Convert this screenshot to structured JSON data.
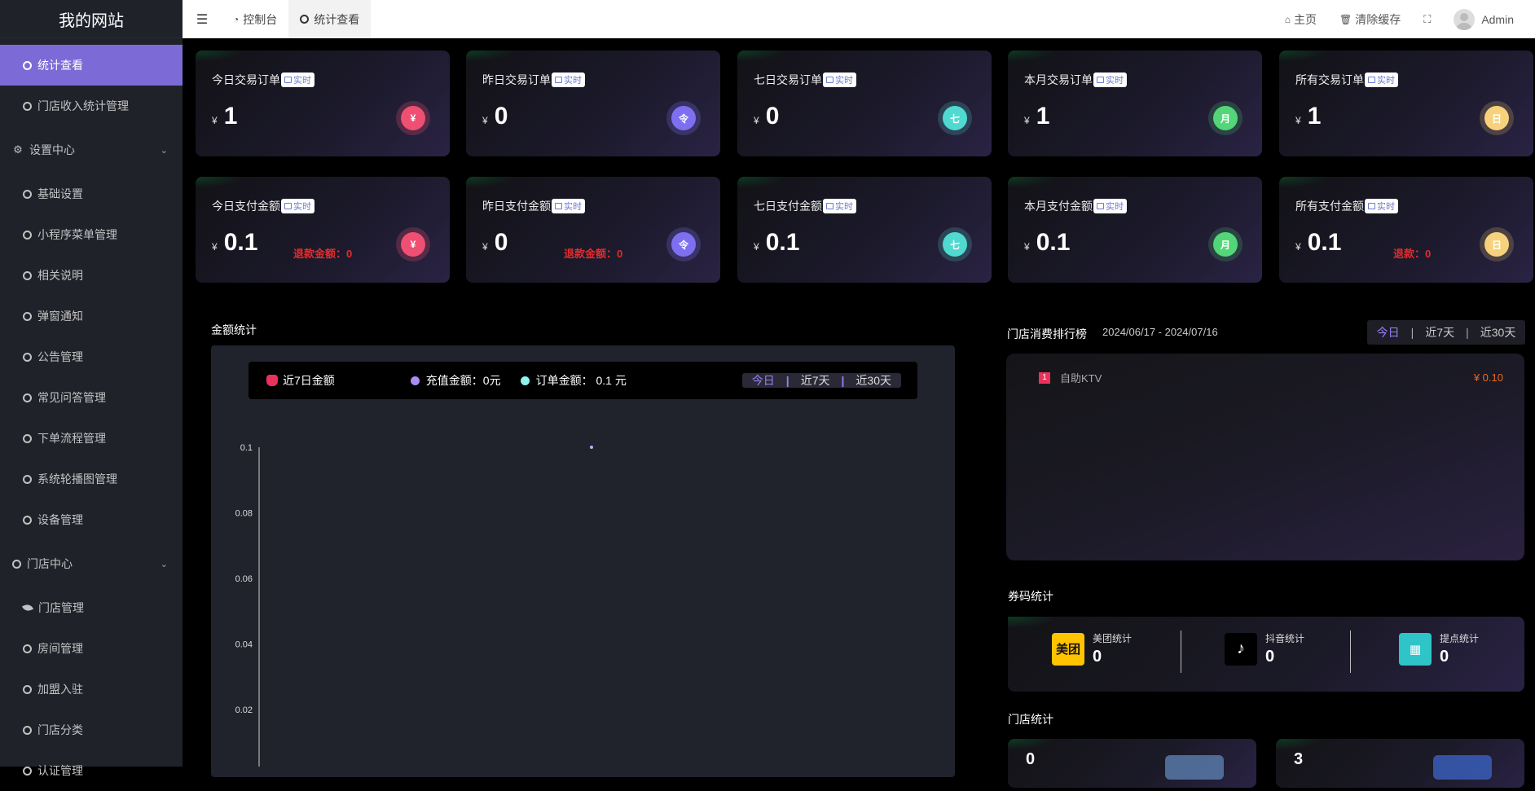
{
  "site": {
    "title": "我的网站"
  },
  "sidebar": {
    "items_top": [
      {
        "label": "统计查看",
        "active": true
      },
      {
        "label": "门店收入统计管理",
        "active": false
      }
    ],
    "group_settings": {
      "label": "设置中心",
      "icon": "gears-icon"
    },
    "settings_items": [
      "基础设置",
      "小程序菜单管理",
      "相关说明",
      "弹窗通知",
      "公告管理",
      "常见问答管理",
      "下单流程管理",
      "系统轮播图管理",
      "设备管理"
    ],
    "group_store": {
      "label": "门店中心"
    },
    "store_items": [
      {
        "label": "门店管理",
        "icon": "leaf-icon"
      },
      {
        "label": "房间管理",
        "icon": "circle-icon"
      },
      {
        "label": "加盟入驻",
        "icon": "circle-icon"
      },
      {
        "label": "门店分类",
        "icon": "circle-icon"
      },
      {
        "label": "认证管理",
        "icon": "circle-icon"
      }
    ]
  },
  "topbar": {
    "tabs": [
      {
        "label": "控制台",
        "icon": "dashboard-icon"
      },
      {
        "label": "统计查看",
        "icon": "circle-icon",
        "active": true
      }
    ],
    "home": "主页",
    "clear_cache": "清除缓存",
    "user": "Admin"
  },
  "badge_label": "实时",
  "currency": "¥",
  "cards_row1": [
    {
      "title": "今日交易订单",
      "value": "1",
      "icon_char": "¥",
      "icon": "yen-icon",
      "color": "red"
    },
    {
      "title": "昨日交易订单",
      "value": "0",
      "icon_char": "令",
      "icon": "yesterday-icon",
      "color": "purple"
    },
    {
      "title": "七日交易订单",
      "value": "0",
      "icon_char": "七",
      "icon": "seven-day-icon",
      "color": "cyan"
    },
    {
      "title": "本月交易订单",
      "value": "1",
      "icon_char": "月",
      "icon": "month-icon",
      "color": "green"
    },
    {
      "title": "所有交易订单",
      "value": "1",
      "icon_char": "日",
      "icon": "all-icon",
      "color": "yellow"
    }
  ],
  "cards_row2": [
    {
      "title": "今日支付金额",
      "value": "0.1",
      "refund": "退款金额：0",
      "icon_char": "¥",
      "icon": "yen-icon",
      "color": "red"
    },
    {
      "title": "昨日支付金额",
      "value": "0",
      "refund": "退款金额：0",
      "icon_char": "令",
      "icon": "yesterday-icon",
      "color": "purple"
    },
    {
      "title": "七日支付金额",
      "value": "0.1",
      "refund": "",
      "icon_char": "七",
      "icon": "seven-day-icon",
      "color": "cyan"
    },
    {
      "title": "本月支付金额",
      "value": "0.1",
      "refund": "",
      "icon_char": "月",
      "icon": "month-icon",
      "color": "green"
    },
    {
      "title": "所有支付金额",
      "value": "0.1",
      "refund": "退款：0",
      "icon_char": "日",
      "icon": "all-icon",
      "color": "yellow"
    }
  ],
  "amount_section": {
    "title": "金额统计",
    "legend_title": "近7日金额",
    "recharge": "充值金额：0元",
    "order": "订单金额：  0.1 元",
    "ranges": [
      "今日",
      "近7天",
      "近30天"
    ],
    "active_range": "今日"
  },
  "chart_data": {
    "type": "line",
    "series": [
      {
        "name": "订单金额",
        "color": "#b9b0ff",
        "values": [
          0.1
        ]
      }
    ],
    "y_ticks": [
      "0.1",
      "0.08",
      "0.06",
      "0.04",
      "0.02"
    ],
    "ylim": [
      0,
      0.1
    ],
    "xlabel": "",
    "ylabel": ""
  },
  "ranking": {
    "title": "门店消费排行榜",
    "date_range": "2024/06/17 - 2024/07/16",
    "ranges": [
      "今日",
      "近7天",
      "近30天"
    ],
    "active_range": "今日",
    "rows": [
      {
        "rank": "1",
        "name": "自助KTV",
        "value": "¥ 0.10"
      }
    ]
  },
  "coupon": {
    "title": "券码统计",
    "items": [
      {
        "name": "美团统计",
        "value": "0",
        "logo_text": "美团"
      },
      {
        "name": "抖音统计",
        "value": "0",
        "logo_text": ""
      },
      {
        "name": "提点统计",
        "value": "0",
        "logo_text": ""
      }
    ]
  },
  "store_stats": {
    "title": "门店统计",
    "values": [
      "0",
      "3"
    ]
  }
}
